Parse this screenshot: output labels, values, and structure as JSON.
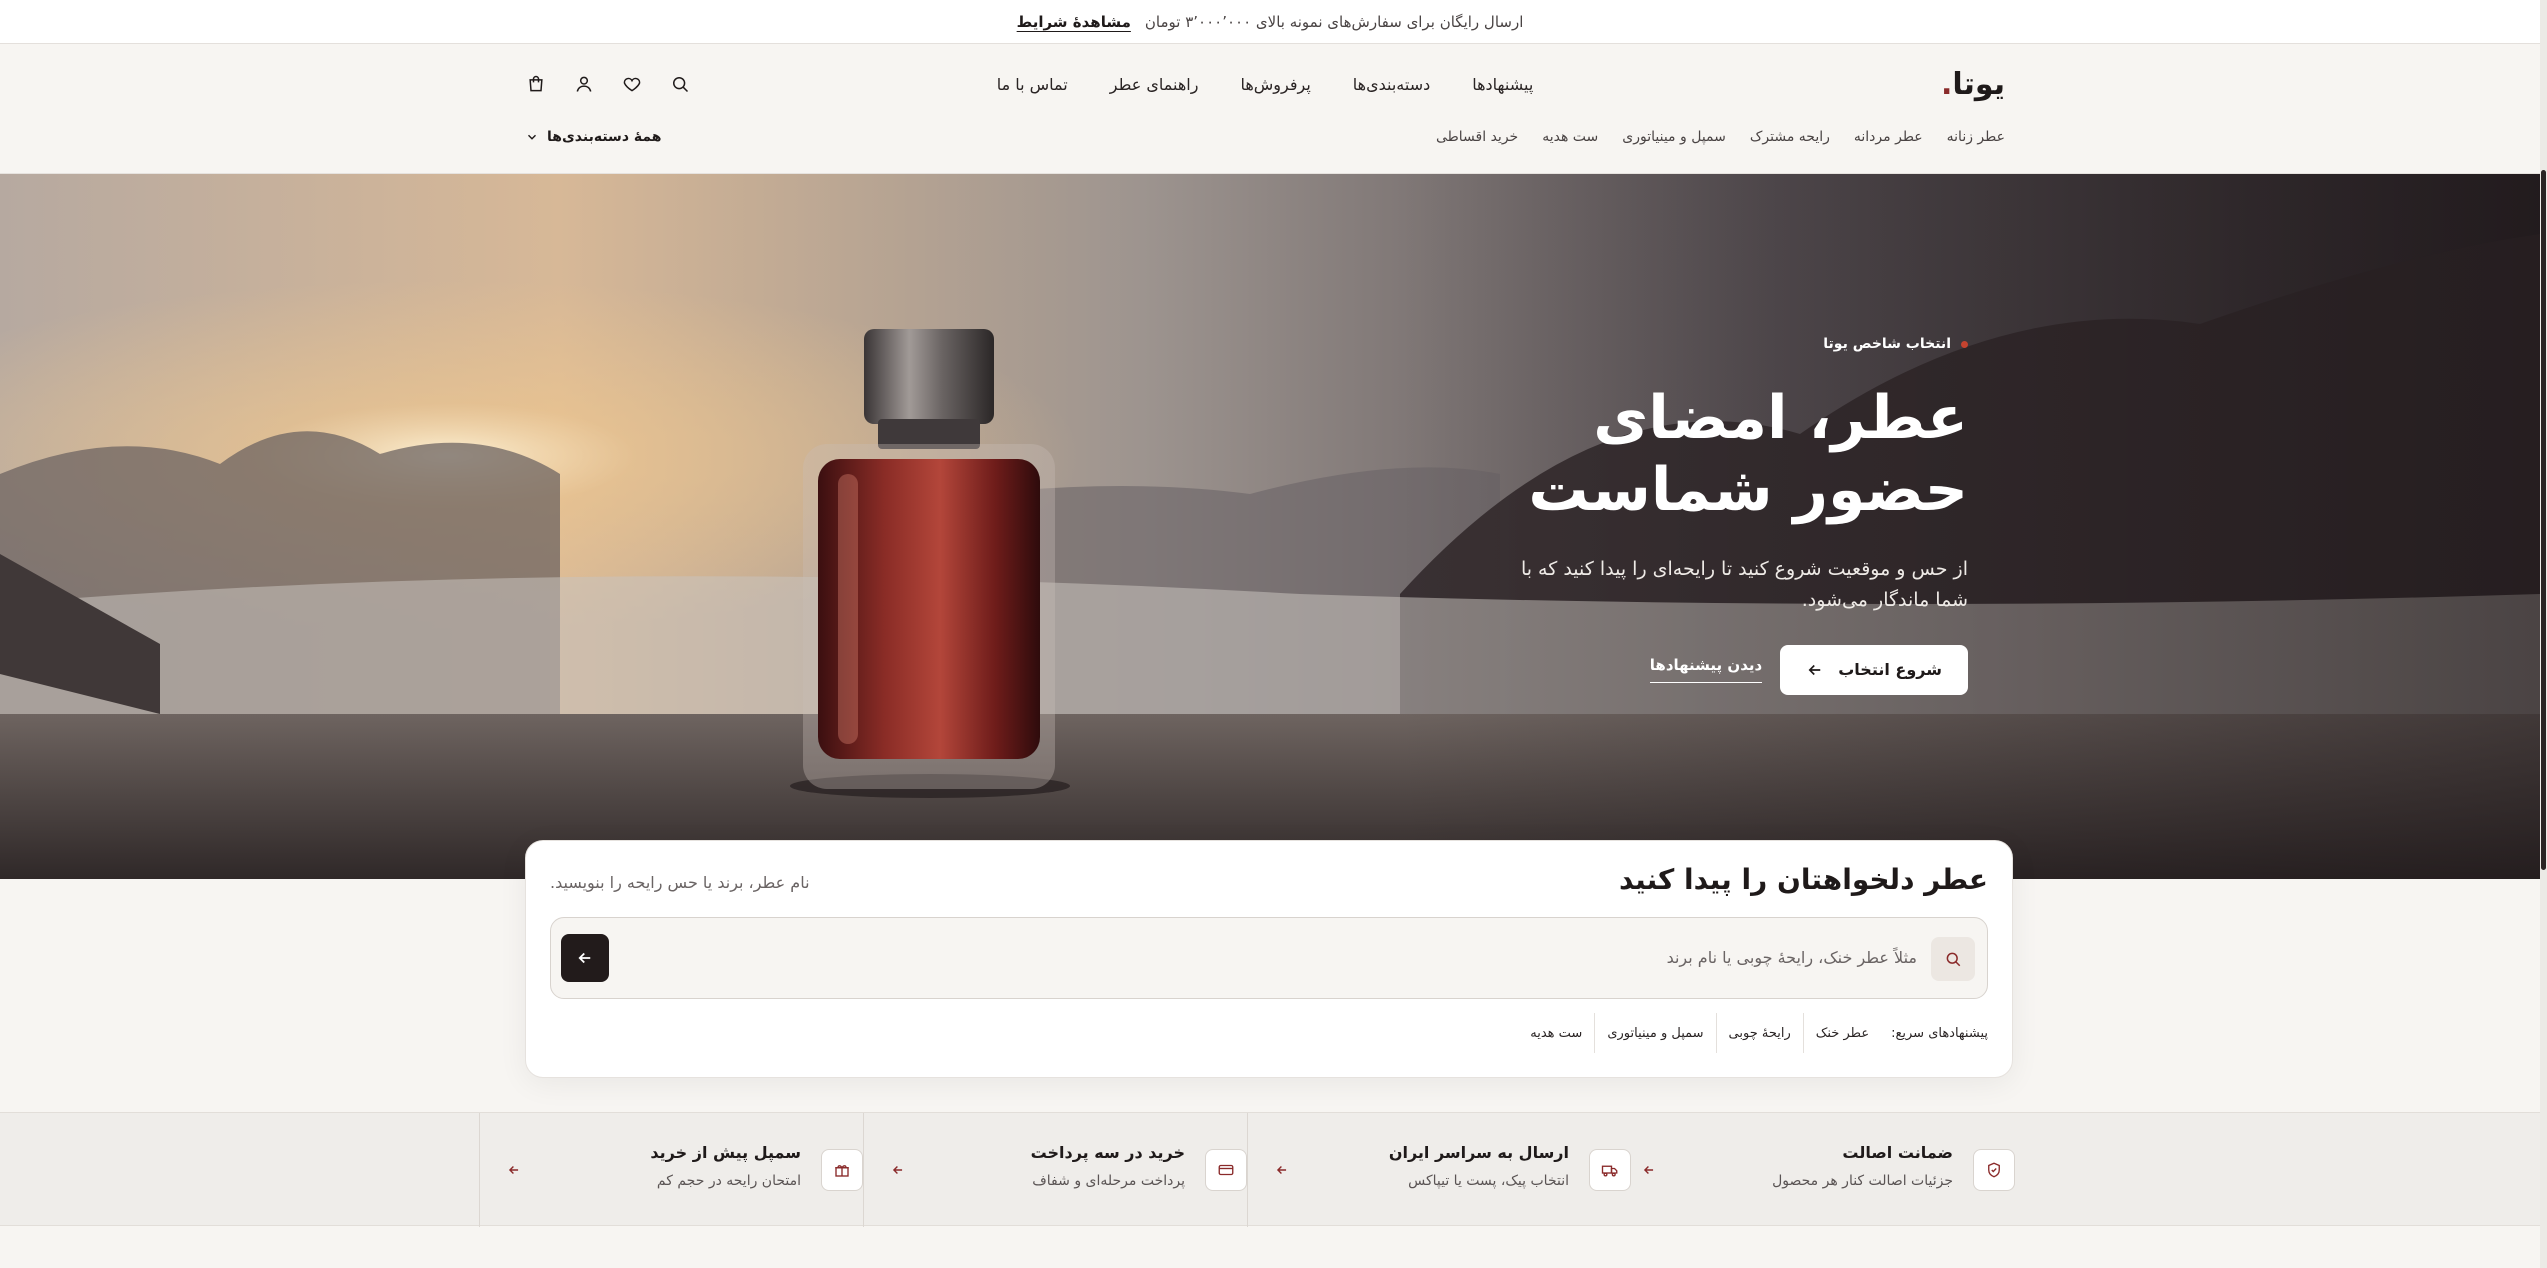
{
  "announcement": {
    "text": "ارسال رایگان برای سفارش‌های نمونه بالای ۳٬۰۰۰٬۰۰۰ تومان",
    "link": "مشاهدهٔ شرایط"
  },
  "header": {
    "logo": "یوتا",
    "logo_dot": ".",
    "nav": [
      "پیشنهادها",
      "دسته‌بندی‌ها",
      "پرفروش‌ها",
      "راهنمای عطر",
      "تماس با ما"
    ],
    "icons": [
      "search-icon",
      "heart-icon",
      "user-icon",
      "bag-icon"
    ],
    "categories": [
      "عطر زنانه",
      "عطر مردانه",
      "رایحه مشترک",
      "سمپل و مینیاتوری",
      "ست هدیه",
      "خرید اقساطی"
    ],
    "all_categories": "همهٔ دسته‌بندی‌ها"
  },
  "hero": {
    "eyebrow": "انتخاب شاخص یوتا",
    "title_line1": "عطر، امضای",
    "title_line2": "حضور شماست",
    "description": "از حس و موقعیت شروع کنید تا رایحه‌ای را پیدا کنید که با شما ماندگار می‌شود.",
    "primary_button": "شروع انتخاب",
    "secondary_link": "دیدن پیشنهادها"
  },
  "search": {
    "title": "عطر دلخواهتان را پیدا کنید",
    "hint": "نام عطر، برند یا حس رایحه را بنویسید.",
    "placeholder": "مثلاً عطر خنک، رایحهٔ چوبی یا نام برند",
    "quick_label": "پیشنهادهای سریع:",
    "chips": [
      "عطر خنک",
      "رایحهٔ چوبی",
      "سمپل و مینیاتوری",
      "ست هدیه"
    ]
  },
  "features": [
    {
      "title": "ضمانت اصالت",
      "subtitle": "جزئیات اصالت کنار هر محصول",
      "icon": "shield-check-icon"
    },
    {
      "title": "ارسال به سراسر ایران",
      "subtitle": "انتخاب پیک، پست یا تیپاکس",
      "icon": "truck-icon"
    },
    {
      "title": "خرید در سه پرداخت",
      "subtitle": "پرداخت مرحله‌ای و شفاف",
      "icon": "credit-card-icon"
    },
    {
      "title": "سمپل پیش از خرید",
      "subtitle": "امتحان رایحه در حجم کم",
      "icon": "gift-icon"
    }
  ],
  "colors": {
    "accent": "#8a2a2a",
    "dark": "#221b1b",
    "background": "#f7f5f2"
  }
}
